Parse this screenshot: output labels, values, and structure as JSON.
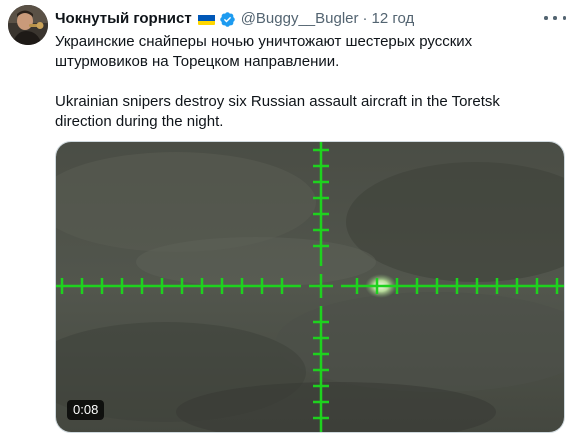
{
  "tweet": {
    "author": {
      "display_name": "Чокнутый горнист",
      "handle": "@Buggy__Bugler",
      "separator": "·",
      "time": "12 год"
    },
    "text": {
      "line_ru": "Украинские снайперы ночью уничтожают шестерых русских штурмовиков на Торецком направлении.",
      "line_en": "Ukrainian snipers destroy six Russian assault aircraft in the Toretsk direction during the night."
    },
    "media": {
      "duration": "0:08"
    }
  },
  "colors": {
    "reticle": "#1ed21e",
    "verified": "#1d9bf0",
    "flag_blue": "#0057b7",
    "flag_yellow": "#ffd700"
  },
  "icons": {
    "avatar": "avatar",
    "flag": "ukraine-flag-icon",
    "verified": "verified-badge-icon",
    "more": "more-icon"
  }
}
